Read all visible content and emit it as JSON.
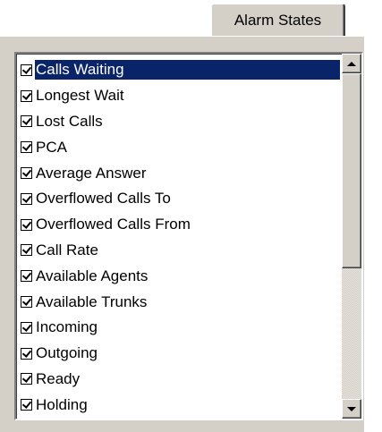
{
  "tab": {
    "label": "Alarm States"
  },
  "list": {
    "items": [
      {
        "label": "Calls Waiting",
        "checked": true,
        "selected": true
      },
      {
        "label": "Longest Wait",
        "checked": true
      },
      {
        "label": "Lost Calls",
        "checked": true
      },
      {
        "label": "PCA",
        "checked": true
      },
      {
        "label": "Average Answer",
        "checked": true
      },
      {
        "label": "Overflowed Calls To",
        "checked": true
      },
      {
        "label": "Overflowed Calls From",
        "checked": true
      },
      {
        "label": "Call Rate",
        "checked": true
      },
      {
        "label": "Available Agents",
        "checked": true
      },
      {
        "label": "Available Trunks",
        "checked": true
      },
      {
        "label": "Incoming",
        "checked": true
      },
      {
        "label": "Outgoing",
        "checked": true
      },
      {
        "label": "Ready",
        "checked": true
      },
      {
        "label": "Holding",
        "checked": true
      }
    ]
  },
  "colors": {
    "selection": "#0a246a",
    "face": "#d4d0c8"
  },
  "icons": {
    "scroll_up": "arrow-up-icon",
    "scroll_down": "arrow-down-icon",
    "check": "checkmark-icon"
  }
}
